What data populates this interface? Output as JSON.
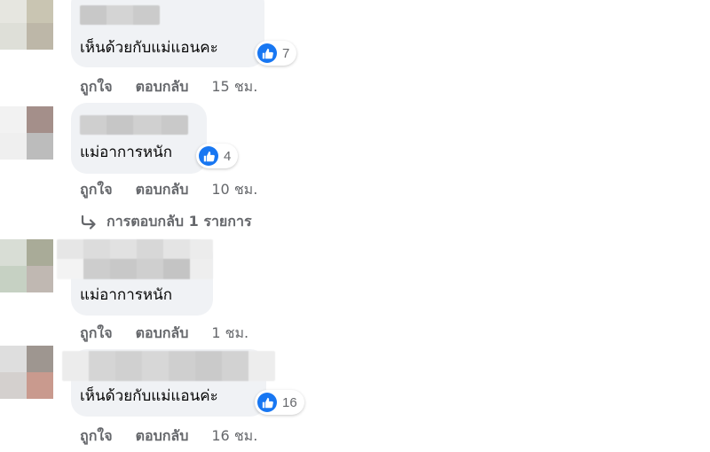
{
  "comments": [
    {
      "text": "เห็นด้วยกับแม่แอนคะ",
      "reaction_count": "7",
      "like_label": "ถูกใจ",
      "reply_label": "ตอบกลับ",
      "time": "15 ชม."
    },
    {
      "text": "แม่อาการหนัก",
      "reaction_count": "4",
      "like_label": "ถูกใจ",
      "reply_label": "ตอบกลับ",
      "time": "10 ชม.",
      "replies_label": "การตอบกลับ 1 รายการ"
    },
    {
      "text": "แม่อาการหนัก",
      "like_label": "ถูกใจ",
      "reply_label": "ตอบกลับ",
      "time": "1 ชม."
    },
    {
      "text": "เห็นด้วยกับแม่แอนค่ะ",
      "reaction_count": "16",
      "like_label": "ถูกใจ",
      "reply_label": "ตอบกลับ",
      "time": "16 ชม."
    }
  ],
  "colors": {
    "bubble": "#f0f2f5",
    "like_blue": "#1877f2",
    "meta_text": "#65676b",
    "text": "#050505"
  },
  "icons": {
    "reaction": "thumbs-up-icon",
    "reply_arrow": "reply-arrow-icon"
  }
}
